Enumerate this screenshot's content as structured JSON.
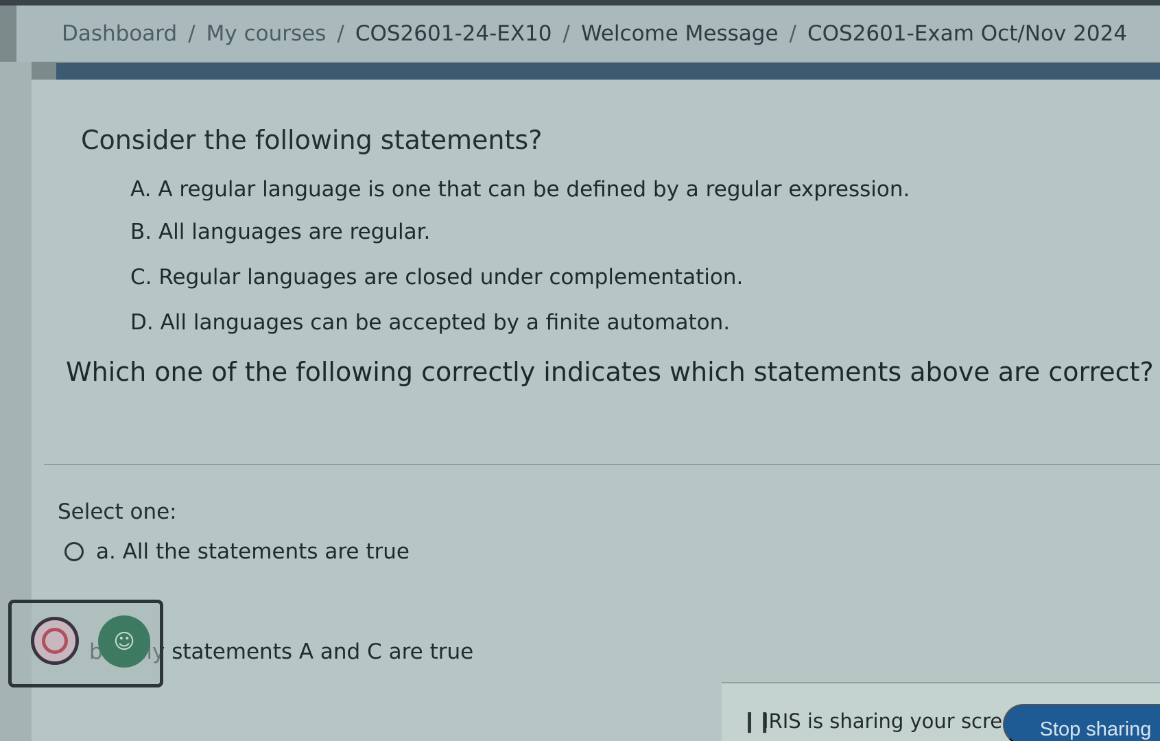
{
  "breadcrumb": {
    "items": [
      "Dashboard",
      "My courses",
      "COS2601-24-EX10",
      "Welcome Message",
      "COS2601-Exam Oct/Nov 2024"
    ],
    "separator": "/"
  },
  "question": {
    "intro": "Consider the following statements?",
    "statements": [
      "A. A regular language is one that can be defined by a regular expression.",
      "B. All languages are regular.",
      "C. Regular languages are closed under complementation.",
      "D. All languages can be accepted by a finite automaton."
    ],
    "ask": "Which one of the following correctly indicates which statements above are correct?"
  },
  "answer": {
    "select_label": "Select one:",
    "options": [
      "a. All the statements are true",
      "b. Only statements A and C are true"
    ]
  },
  "share_banner": {
    "text": "IRIS is sharing your screen.",
    "stop_label": "Stop sharing"
  },
  "colors": {
    "accent_blue": "#1e5a94",
    "rule_blue": "#3c5a72",
    "panel_bg": "#b5c6c4"
  },
  "icons": {
    "camera": "camera-icon",
    "face": "face-icon",
    "pause": "pause-icon",
    "radio": "radio-icon"
  }
}
